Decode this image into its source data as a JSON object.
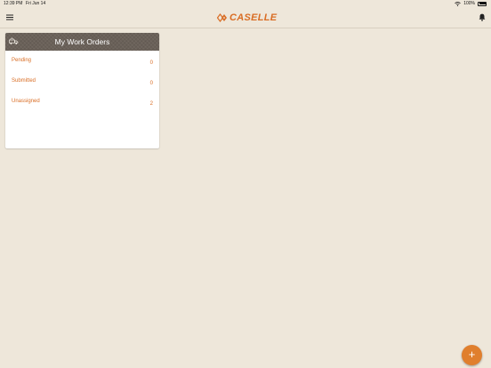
{
  "status_bar": {
    "time": "12:39 PM",
    "date": "Fri Jun 14",
    "battery": "100%",
    "wifi_icon": "wifi-icon",
    "battery_icon": "battery-icon"
  },
  "header": {
    "menu_icon": "hamburger-menu-icon",
    "logo_text": "CASELLE",
    "notification_icon": "bell-icon"
  },
  "colors": {
    "background": "#eee7da",
    "accent": "#d96d24",
    "card_header": "#6a6159",
    "fab": "#e07f2d"
  },
  "work_orders": {
    "title": "My Work Orders",
    "header_icon": "truck-icon",
    "rows": [
      {
        "label": "Pending",
        "count": "0"
      },
      {
        "label": "Submitted",
        "count": "0"
      },
      {
        "label": "Unassigned",
        "count": "2"
      }
    ]
  },
  "fab": {
    "label": "+",
    "icon": "plus-icon"
  }
}
